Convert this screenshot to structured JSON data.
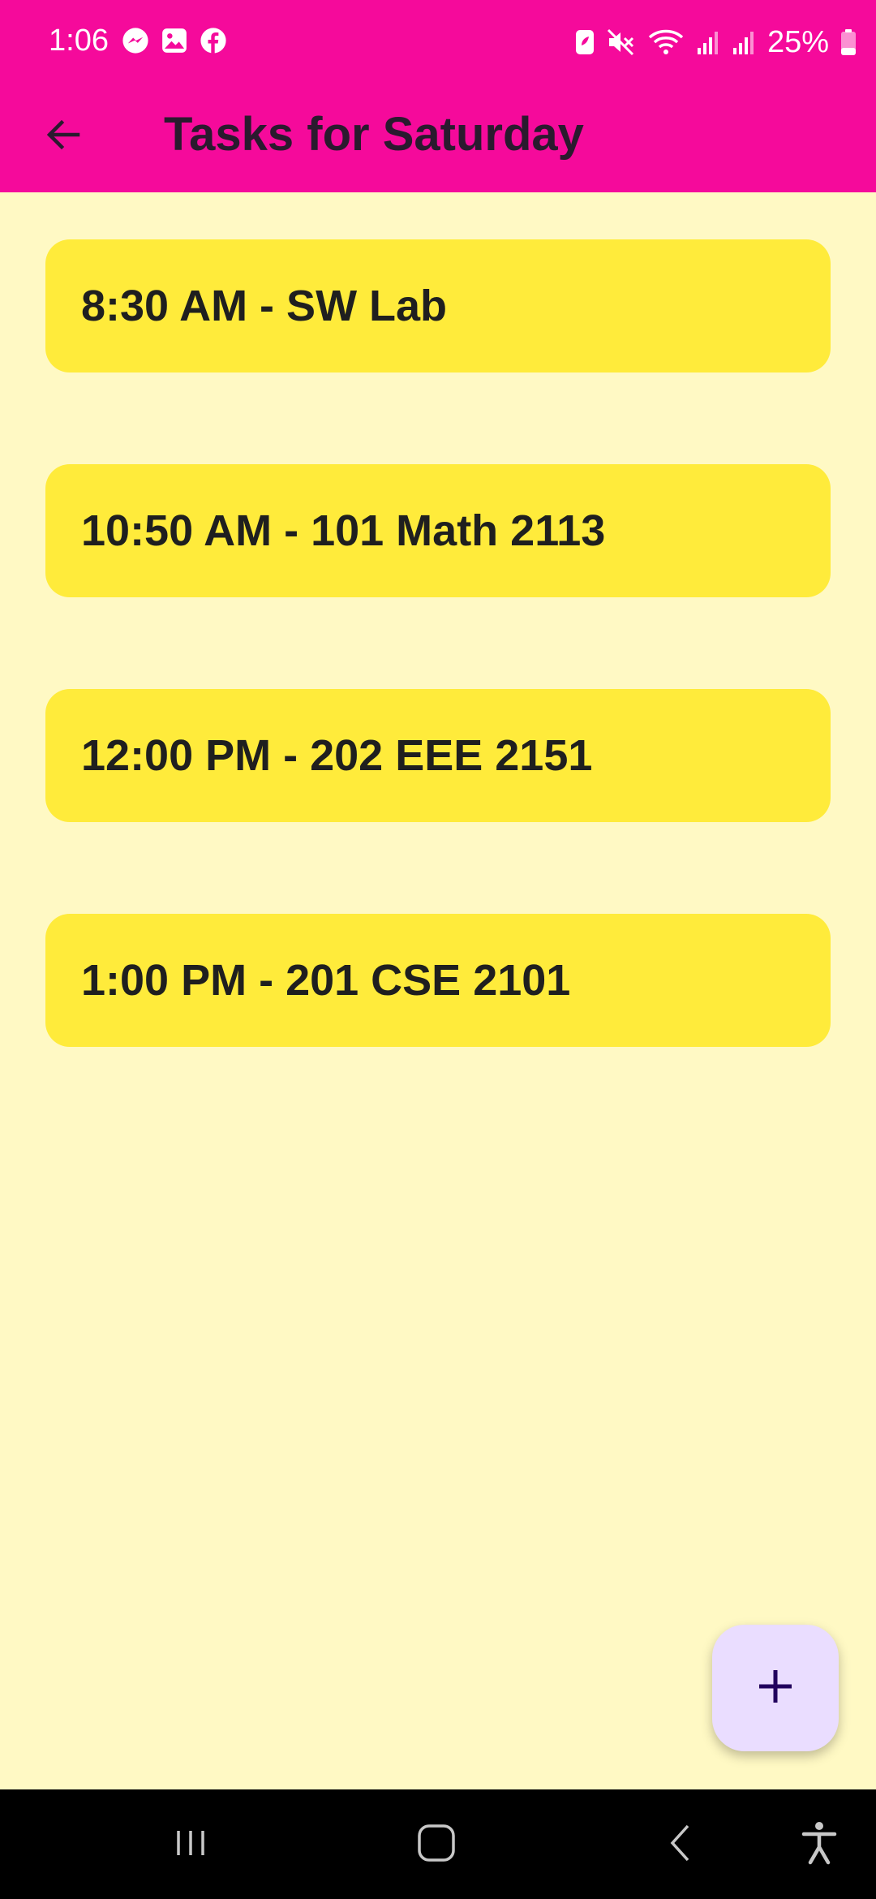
{
  "status_bar": {
    "time": "1:06",
    "battery_percent": "25%",
    "notification_icons": [
      "messenger-icon",
      "gallery-icon",
      "facebook-icon"
    ],
    "system_icons": [
      "battery-saver-icon",
      "mute-icon",
      "wifi-icon",
      "signal-icon",
      "signal-icon",
      "battery-icon"
    ]
  },
  "app_bar": {
    "back_icon": "arrow-left-icon",
    "title": "Tasks for Saturday"
  },
  "tasks": [
    {
      "label": "8:30 AM - SW Lab"
    },
    {
      "label": "10:50 AM - 101 Math 2113"
    },
    {
      "label": "12:00 PM - 202 EEE 2151"
    },
    {
      "label": "1:00 PM - 201 CSE 2101"
    }
  ],
  "fab": {
    "icon": "plus-icon"
  },
  "nav_bar": {
    "items": [
      "recent-apps-icon",
      "home-icon",
      "back-icon",
      "accessibility-icon"
    ]
  },
  "colors": {
    "app_bar": "#F50A9B",
    "background": "#FFF9C4",
    "task_card": "#FFEB3B",
    "fab": "#EADDFF",
    "nav_bar": "#000000"
  }
}
